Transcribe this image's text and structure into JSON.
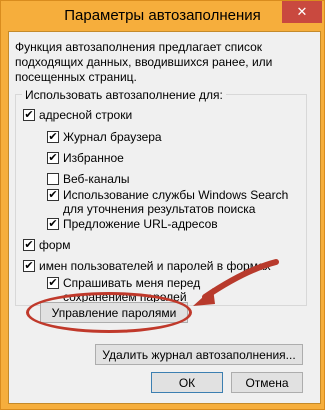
{
  "window": {
    "title": "Параметры автозаполнения",
    "close_glyph": "✕"
  },
  "description": "Функция автозаполнения предлагает список подходящих данных, вводившихся ранее, или посещенных страниц.",
  "group_label": "Использовать автозаполнение для:",
  "options": {
    "address_bar": {
      "label": "адресной строки",
      "checked": true
    },
    "browser_history": {
      "label": "Журнал браузера",
      "checked": true
    },
    "favorites": {
      "label": "Избранное",
      "checked": true
    },
    "web_feeds": {
      "label": "Веб-каналы",
      "checked": false
    },
    "windows_search": {
      "label": "Использование службы Windows Search для уточнения результатов поиска",
      "checked": true
    },
    "url_suggestions": {
      "label": "Предложение URL-адресов",
      "checked": true
    },
    "forms": {
      "label": "форм",
      "checked": true
    },
    "usernames_passwords": {
      "label": "имен пользователей и паролей в формах",
      "checked": true
    },
    "ask_before_saving": {
      "label": "Спрашивать меня перед сохранением паролей",
      "checked": true
    }
  },
  "check_glyph": "✔",
  "buttons": {
    "manage_passwords": "Управление паролями",
    "delete_history": "Удалить журнал автозаполнения...",
    "ok": "ОК",
    "cancel": "Отмена"
  },
  "annotation_color": "#c0392b"
}
